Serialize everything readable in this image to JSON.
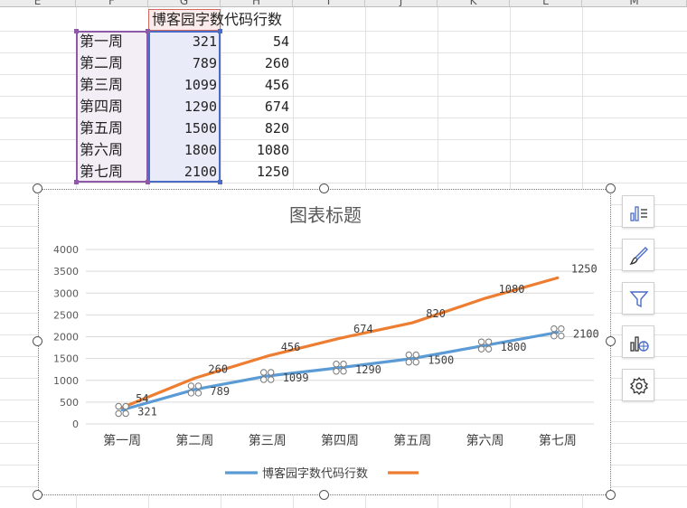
{
  "spreadsheet": {
    "column_headers": [
      "E",
      "F",
      "G",
      "H",
      "I",
      "J",
      "K",
      "L",
      "M"
    ],
    "header_cell": "博客园字数代码行数",
    "rows": [
      {
        "week": "第一周",
        "words": 321,
        "lines": 54
      },
      {
        "week": "第二周",
        "words": 789,
        "lines": 260
      },
      {
        "week": "第三周",
        "words": 1099,
        "lines": 456
      },
      {
        "week": "第四周",
        "words": 1290,
        "lines": 674
      },
      {
        "week": "第五周",
        "words": 1500,
        "lines": 820
      },
      {
        "week": "第六周",
        "words": 1800,
        "lines": 1080
      },
      {
        "week": "第七周",
        "words": 2100,
        "lines": 1250
      }
    ]
  },
  "chart_data": {
    "type": "line",
    "title": "图表标题",
    "categories": [
      "第一周",
      "第二周",
      "第三周",
      "第四周",
      "第五周",
      "第六周",
      "第七周"
    ],
    "ylim": [
      0,
      4000
    ],
    "yticks": [
      0,
      500,
      1000,
      1500,
      2000,
      2500,
      3000,
      3500,
      4000
    ],
    "grid": true,
    "legend_position": "bottom",
    "series": [
      {
        "name": "博客园字数代码行数",
        "color": "#5b9bd5",
        "values": [
          321,
          789,
          1099,
          1290,
          1500,
          1800,
          2100
        ],
        "labels": [
          321,
          789,
          1099,
          1290,
          1500,
          1800,
          2100
        ],
        "selected": true
      },
      {
        "name": "",
        "color": "#ed7d31",
        "values": [
          375,
          1049,
          1555,
          1964,
          2320,
          2880,
          3350
        ],
        "labels": [
          54,
          260,
          456,
          674,
          820,
          1080,
          1250
        ]
      }
    ]
  },
  "side_buttons": [
    {
      "name": "chart-elements-icon"
    },
    {
      "name": "chart-styles-icon"
    },
    {
      "name": "chart-filter-icon"
    },
    {
      "name": "chart-data-icon"
    },
    {
      "name": "chart-settings-icon"
    }
  ],
  "colors": {
    "accent_blue": "#4a6cc6",
    "accent_purple": "#8e5aa8",
    "series1": "#5b9bd5",
    "series2": "#ed7d31"
  }
}
